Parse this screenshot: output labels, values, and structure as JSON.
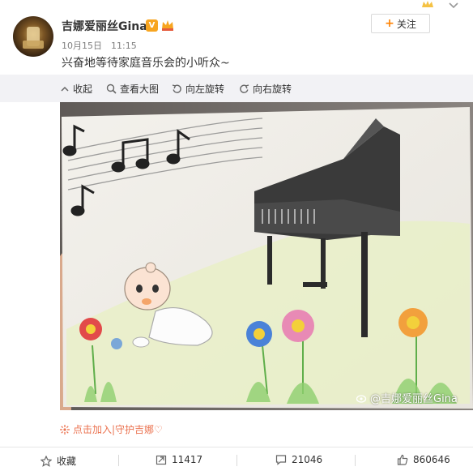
{
  "user": {
    "name": "吉娜爱丽丝Gina",
    "verified_badge": "V"
  },
  "post": {
    "date": "10月15日",
    "time": "11:15",
    "text": "兴奋地等待家庭音乐会的小听众~"
  },
  "follow": {
    "label": "关注"
  },
  "toolbar": {
    "collapse": "收起",
    "view_large": "查看大图",
    "rotate_left": "向左旋转",
    "rotate_right": "向右旋转"
  },
  "image": {
    "watermark": "@吉娜爱丽丝Gina"
  },
  "fans_link": "点击加入|守护吉娜♡",
  "actions": {
    "favorite": "收藏",
    "repost": "11417",
    "comment": "21046",
    "like": "860646"
  },
  "colors": {
    "accent": "#ff8200",
    "fans": "#eb7350"
  }
}
